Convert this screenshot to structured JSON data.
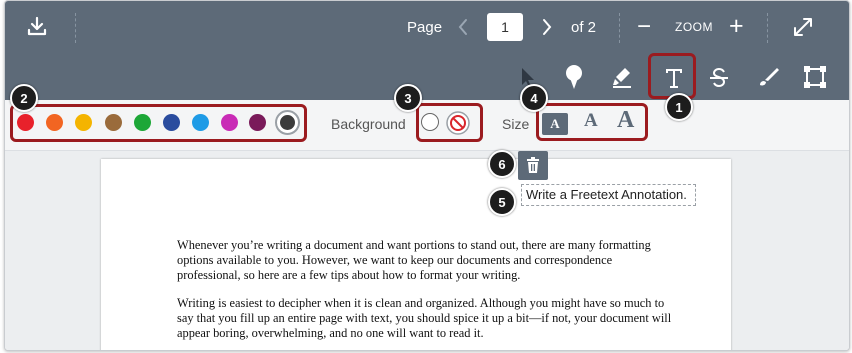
{
  "toolbar": {
    "download_icon": "download-icon",
    "page_label": "Page",
    "current_page": "1",
    "of_label": "of 2",
    "zoom_label": "ZOOM",
    "zoom_out": "−",
    "zoom_in": "+",
    "tools": [
      "cursor-icon",
      "pin-icon",
      "highlighter-icon",
      "text-tool-icon",
      "strikeout-icon",
      "draw-icon",
      "area-icon"
    ]
  },
  "options": {
    "colors": [
      "#e8212b",
      "#f26522",
      "#f4b400",
      "#9a6b3b",
      "#1da737",
      "#2a4c9e",
      "#1e9be6",
      "#c92bb6",
      "#7a1b5a",
      "#3c3c3c"
    ],
    "background_label": "Background",
    "size_label": "Size",
    "sizes": [
      "A",
      "A",
      "A"
    ]
  },
  "annotation": {
    "text": "Write a Freetext Annotation.",
    "delete_icon": "trash-icon"
  },
  "document": {
    "paragraph1": "Whenever you’re writing a document and want portions to stand out, there are many formatting options available to you. However, we want to keep our documents and correspondence professional, so here are a few tips about how to format your writing.",
    "paragraph2": "Writing is easiest to decipher when it is clean and organized. Although you might have so much to say that you fill up an entire page with text, you should spice it up a bit—if not, your document will appear boring, overwhelming, and no one will want to read it."
  },
  "callouts": [
    "1",
    "2",
    "3",
    "4",
    "5",
    "6"
  ]
}
